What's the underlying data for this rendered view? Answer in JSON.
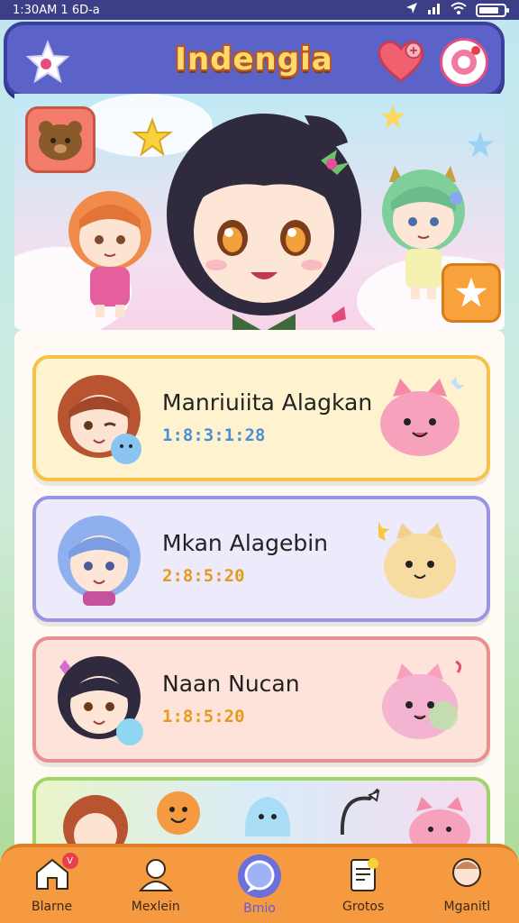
{
  "status": {
    "left_text": "1:30AM 1 6D-a",
    "icons": [
      "navigation-icon",
      "signal-icon",
      "wifi-icon",
      "battery-icon"
    ]
  },
  "header": {
    "title": "Indengia",
    "left_icon": "star-badge-icon",
    "heart_icon": "heart-icon",
    "settings_icon": "gear-icon"
  },
  "list": [
    {
      "name": "Manriuiita Alagkan",
      "time": "1:8:3:1:28",
      "theme": "yellow"
    },
    {
      "name": "Mkan Alagebin",
      "time": "2:8:5:20",
      "theme": "purple"
    },
    {
      "name": "Naan Nucan",
      "time": "1:8:5:20",
      "theme": "pink"
    }
  ],
  "bottom_nav": [
    {
      "label": "Blarne",
      "icon": "home-icon",
      "badge": "V"
    },
    {
      "label": "Mexlein",
      "icon": "profile-icon"
    },
    {
      "label": "Bmio",
      "icon": "chat-icon",
      "active": true
    },
    {
      "label": "Grotos",
      "icon": "document-icon"
    },
    {
      "label": "Mganitl",
      "icon": "avatar-icon"
    }
  ],
  "colors": {
    "header_bg": "#5b63c9",
    "title": "#ffd96a",
    "nav_bg": "#f59a40",
    "card_yellow": "#f5c14a",
    "card_purple": "#9a95e0",
    "card_pink": "#ea8f8f",
    "time_yellow": "#4a8fd6",
    "time_other": "#e69a1b"
  }
}
